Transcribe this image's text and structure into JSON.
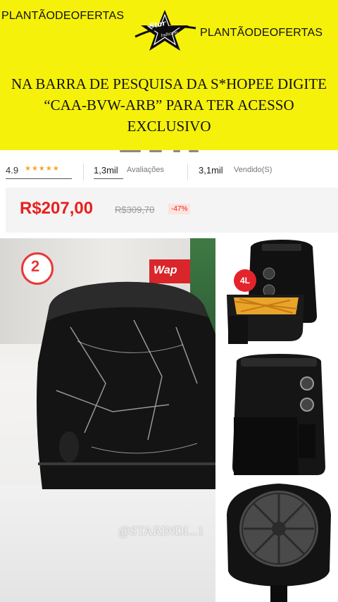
{
  "banner": {
    "brand_left": "PLANTÃODEOFERTAS",
    "brand_right": "PLANTÃODEOFERTAS",
    "logo_text": "Star",
    "logo_subtext": "Indicam",
    "headline": "NA BARRA DE PESQUISA DA S*HOPEE DIGITE “CAA-BVW-ARB” PARA TER ACESSO EXCLUSIVO",
    "background_color": "#f5f10a"
  },
  "product": {
    "rating": "4.9",
    "stars": "★★★★★",
    "reviews_count": "1,3mil",
    "reviews_label": "Avaliações",
    "sold_count": "3,1mil",
    "sold_label": "Vendido(S)",
    "price": "R$207,00",
    "old_price": "R$309,70",
    "discount": "-47%",
    "price_color": "#e8201e"
  },
  "photo": {
    "badge_number": "2",
    "brand_sign": "Wap",
    "watermark": "@STARINDI...1"
  },
  "panel": {
    "capacity_badge": "4L"
  },
  "icons": [
    "star-logo-icon",
    "rating-star-icon"
  ]
}
